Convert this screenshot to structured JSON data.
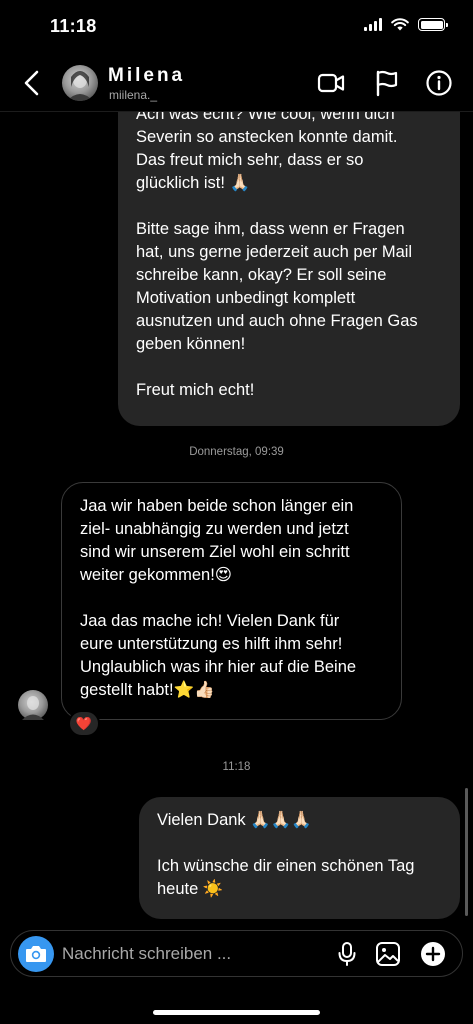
{
  "status_bar": {
    "time": "11:18"
  },
  "header": {
    "name": "Milena",
    "username": "miilena._"
  },
  "messages": {
    "outgoing_1": {
      "partial_top": "Ach was echt? Wie cool, wenn dich",
      "p1": "Severin so anstecken konnte damit.\nDas freut mich sehr, dass er so\nglücklich ist! 🙏🏻",
      "p2": "Bitte sage ihm, dass wenn er Fragen\nhat, uns gerne jederzeit auch per Mail\nschreibe kann, okay? Er soll seine\nMotivation unbedingt komplett\nausnutzen und auch ohne Fragen Gas\ngeben können!",
      "p3": "Freut mich echt!"
    },
    "timestamp_1": "Donnerstag, 09:39",
    "incoming_1": {
      "p1": "Jaa wir haben beide schon länger ein\nziel- unabhängig zu werden und jetzt\nsind wir unserem Ziel wohl ein schritt\nweiter gekommen!😍",
      "p2": "Jaa das mache ich! Vielen Dank für\neure unterstützung es hilft ihm sehr!\nUnglaublich was ihr hier auf die Beine\ngestellt habt!⭐👍🏻",
      "reaction": "❤️"
    },
    "timestamp_2": "11:18",
    "outgoing_2": {
      "p1": "Vielen Dank 🙏🏻🙏🏻🙏🏻",
      "p2": "Ich wünsche dir einen schönen Tag\nheute ☀️"
    }
  },
  "composer": {
    "placeholder": "Nachricht schreiben ..."
  },
  "icons": {
    "back": "chevron-left-icon",
    "video": "video-camera-icon",
    "flag": "flag-icon",
    "info": "info-icon",
    "camera": "camera-icon",
    "mic": "microphone-icon",
    "gallery": "image-icon",
    "add": "plus-circle-icon"
  },
  "colors": {
    "background": "#000000",
    "outgoing_bubble": "#262626",
    "incoming_border": "#3a3a3a",
    "camera_button": "#3797f0",
    "secondary_text": "#a8a8a8"
  }
}
